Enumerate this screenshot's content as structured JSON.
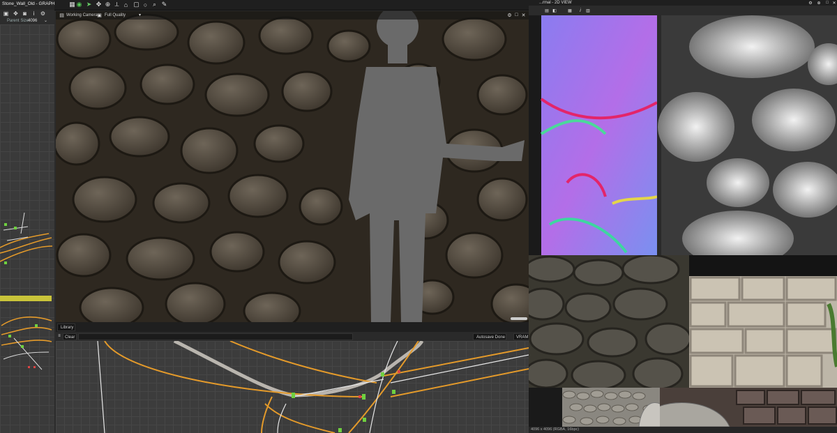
{
  "app": {
    "window_title": "Stone_Wall_Old - GRAPH",
    "parent_size_label": "Parent Size:",
    "parent_size_value": "4096"
  },
  "view3d": {
    "camera_label": "Working Camera",
    "quality_label": "Full Quality"
  },
  "library": {
    "tab_label": "Library",
    "clear_label": "Clear",
    "autosave_label": "Autosave Done",
    "vram_label": "VRAM"
  },
  "view2d": {
    "title": "...rmal - 2D VIEW",
    "status": "4096 x 4096 (RGBA, 16bpc)"
  },
  "colors": {
    "accent_orange": "#e49a2a",
    "node_green": "#6fd040",
    "selection_yellow": "#c9c43a"
  },
  "icons": [
    "grid-icon",
    "move-icon",
    "camera-icon",
    "info-icon",
    "settings-icon",
    "pointer-icon",
    "rotate-icon",
    "axis-icon",
    "scene-icon",
    "box-icon",
    "circle-icon",
    "search-icon",
    "pen-icon"
  ]
}
